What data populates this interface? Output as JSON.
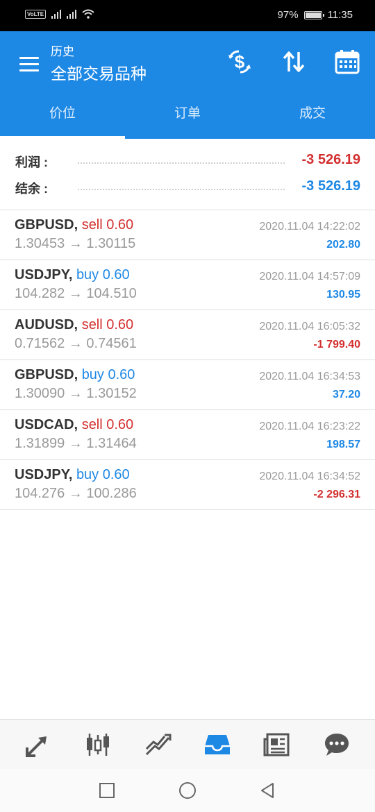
{
  "status_bar": {
    "volte": "VoLTE",
    "battery": "97%",
    "time": "11:35"
  },
  "header": {
    "subtitle": "历史",
    "title": "全部交易品种",
    "icons": [
      "currency-exchange-icon",
      "sort-icon",
      "calendar-icon"
    ]
  },
  "tabs": [
    {
      "label": "价位",
      "active": true
    },
    {
      "label": "订单",
      "active": false
    },
    {
      "label": "成交",
      "active": false
    }
  ],
  "summary": {
    "profit_label": "利润 :",
    "profit_value": "-3 526.19",
    "balance_label": "结余 :",
    "balance_value": "-3 526.19"
  },
  "trades": [
    {
      "symbol": "GBPUSD,",
      "side": "sell 0.60",
      "prices": "1.30453 → 1.30115",
      "time": "2020.11.04 14:22:02",
      "profit": "202.80"
    },
    {
      "symbol": "USDJPY,",
      "side": "buy 0.60",
      "prices": "104.282 → 104.510",
      "time": "2020.11.04 14:57:09",
      "profit": "130.95"
    },
    {
      "symbol": "AUDUSD,",
      "side": "sell 0.60",
      "prices": "0.71562 → 0.74561",
      "time": "2020.11.04 16:05:32",
      "profit": "-1 799.40"
    },
    {
      "symbol": "GBPUSD,",
      "side": "buy 0.60",
      "prices": "1.30090 → 1.30152",
      "time": "2020.11.04 16:34:53",
      "profit": "37.20"
    },
    {
      "symbol": "USDCAD,",
      "side": "sell 0.60",
      "prices": "1.31899 → 1.31464",
      "time": "2020.11.04 16:23:22",
      "profit": "198.57"
    },
    {
      "symbol": "USDJPY,",
      "side": "buy 0.60",
      "prices": "104.276 → 100.286",
      "time": "2020.11.04 16:34:52",
      "profit": "-2 296.31"
    }
  ],
  "bottom_nav": [
    "quotes-arrows-icon",
    "candlestick-chart-icon",
    "trend-chart-icon",
    "inbox-history-icon",
    "news-icon",
    "chat-icon"
  ],
  "colors": {
    "accent": "#1e88e5",
    "negative": "#d32f2f",
    "positive": "#1e88e5"
  }
}
